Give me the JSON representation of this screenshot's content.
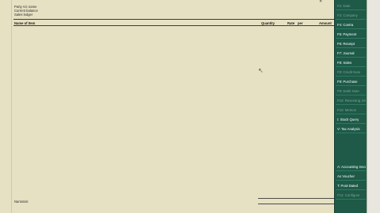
{
  "voucher": {
    "fields": [
      "Party A/c name",
      "Current balance",
      "Sales ledger"
    ],
    "columns": {
      "name_of_item": "Name of Item",
      "quantity": "Quantity",
      "rate": "Rate",
      "per": "per",
      "amount": "Amount"
    },
    "narration_label": "Narration:"
  },
  "sidebar": {
    "items": [
      {
        "label": "F2: Date",
        "dim": true
      },
      {
        "label": "F3: Company",
        "dim": true
      },
      {
        "label": "F4: Contra",
        "dim": false
      },
      {
        "label": "F5: Payment",
        "dim": false
      },
      {
        "label": "F6: Receipt",
        "dim": false
      },
      {
        "label": "F7: Journal",
        "dim": false
      },
      {
        "label": "F8: Sales",
        "dim": false
      },
      {
        "label": "F8: Credit Note",
        "dim": true
      },
      {
        "label": "F9: Purchase",
        "dim": false
      },
      {
        "label": "F9: Debit Note",
        "dim": true
      },
      {
        "label": "F10: Reversing Jrnl",
        "dim": true
      },
      {
        "label": "F10: Memos",
        "dim": true
      },
      {
        "label": "I: Stock Query",
        "dim": false
      },
      {
        "label": "V: Tax Analysis",
        "dim": false
      },
      {
        "label": "A: Accounting Invoice",
        "dim": false
      },
      {
        "label": "As Voucher",
        "dim": false
      },
      {
        "label": "T: Post-Dated",
        "dim": false
      },
      {
        "label": "F12: Configure",
        "dim": true
      }
    ]
  }
}
